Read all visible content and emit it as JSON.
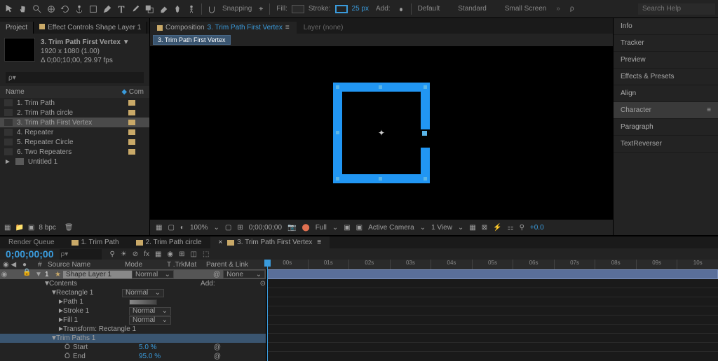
{
  "toolbar": {
    "snapping": "Snapping",
    "fill": "Fill:",
    "stroke": "Stroke:",
    "stroke_px": "25 px",
    "add": "Add:",
    "workspace1": "Default",
    "workspace2": "Standard",
    "workspace3": "Small Screen",
    "search_placeholder": "Search Help"
  },
  "project": {
    "tab1": "Project",
    "tab2": "Effect Controls Shape Layer 1",
    "title": "3. Trim Path First Vertex",
    "dims": "1920 x 1080 (1.00)",
    "delta": "Δ 0;00;10;00, 29.97 fps",
    "search_placeholder": "ρ▾",
    "col_name": "Name",
    "col_type": "Com",
    "items": [
      {
        "label": "1. Trim Path"
      },
      {
        "label": "2. Trim Path circle"
      },
      {
        "label": "3. Trim Path First Vertex"
      },
      {
        "label": "4. Repeater"
      },
      {
        "label": "5. Repeater Circle"
      },
      {
        "label": "6. Two Repeaters"
      },
      {
        "label": "Untitled 1"
      }
    ],
    "bpc": "8 bpc"
  },
  "viewer": {
    "tab_comp": "Composition",
    "tab_comp_name": "3. Trim Path First Vertex",
    "tab_layer": "Layer (none)",
    "subtab": "3. Trim Path First Vertex",
    "zoom": "100%",
    "time": "0;00;00;00",
    "quality": "Full",
    "camera": "Active Camera",
    "views": "1 View",
    "exposure": "+0.0"
  },
  "right": {
    "items": [
      "Info",
      "Tracker",
      "Preview",
      "Effects & Presets",
      "Align",
      "Character",
      "Paragraph",
      "TextReverser"
    ],
    "active_index": 5
  },
  "timeline": {
    "tabs": [
      {
        "label": "Render Queue"
      },
      {
        "label": "1. Trim Path"
      },
      {
        "label": "2. Trim Path circle"
      },
      {
        "label": "3. Trim Path First Vertex"
      }
    ],
    "active_tab": 3,
    "timecode": "0;00;00;00",
    "cols": {
      "num": "#",
      "source": "Source Name",
      "mode": "Mode",
      "trkmat": "T .TrkMat",
      "parent": "Parent & Link"
    },
    "layer": {
      "num": "1",
      "name": "Shape Layer 1",
      "mode": "Normal",
      "parent": "None"
    },
    "contents": "Contents",
    "add": "Add:",
    "props": [
      {
        "name": "Rectangle 1",
        "mode": "Normal",
        "expand": "▼"
      },
      {
        "name": "Path 1",
        "mode": "",
        "expand": "►"
      },
      {
        "name": "Stroke 1",
        "mode": "Normal",
        "expand": "►"
      },
      {
        "name": "Fill 1",
        "mode": "Normal",
        "expand": "►"
      },
      {
        "name": "Transform: Rectangle 1",
        "mode": "",
        "expand": "►"
      },
      {
        "name": "Trim Paths 1",
        "mode": "",
        "expand": "▼"
      }
    ],
    "trim": [
      {
        "name": "Start",
        "val": "5.0 %"
      },
      {
        "name": "End",
        "val": "95.0 %"
      }
    ],
    "ticks": [
      "00s",
      "01s",
      "02s",
      "03s",
      "04s",
      "05s",
      "06s",
      "07s",
      "08s",
      "09s",
      "10s"
    ]
  }
}
